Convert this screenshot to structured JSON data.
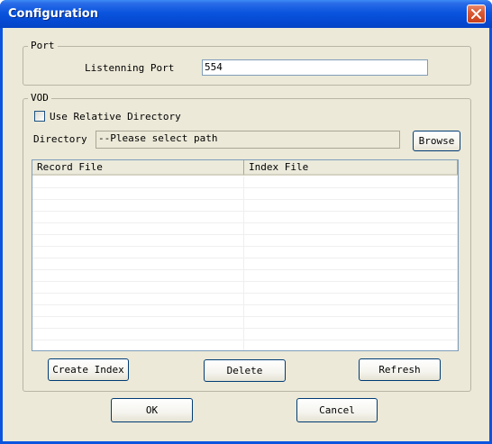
{
  "window": {
    "title": "Configuration"
  },
  "port_group": {
    "label": "Port",
    "listening_port_label": "Listenning Port",
    "listening_port_value": "554"
  },
  "vod_group": {
    "label": "VOD",
    "use_relative_label": "Use Relative Directory",
    "use_relative_checked": false,
    "directory_label": "Directory",
    "directory_value": "--Please select path",
    "browse_label": "Browse",
    "columns": [
      "Record File",
      "Index File"
    ],
    "rows": [],
    "create_index_label": "Create Index",
    "delete_label": "Delete",
    "refresh_label": "Refresh"
  },
  "footer": {
    "ok_label": "OK",
    "cancel_label": "Cancel"
  },
  "colors": {
    "titlebar": "#0a55de",
    "dialog_face": "#ece9d8",
    "close_button": "#c8411c"
  },
  "icons": {
    "close": "close-icon"
  }
}
